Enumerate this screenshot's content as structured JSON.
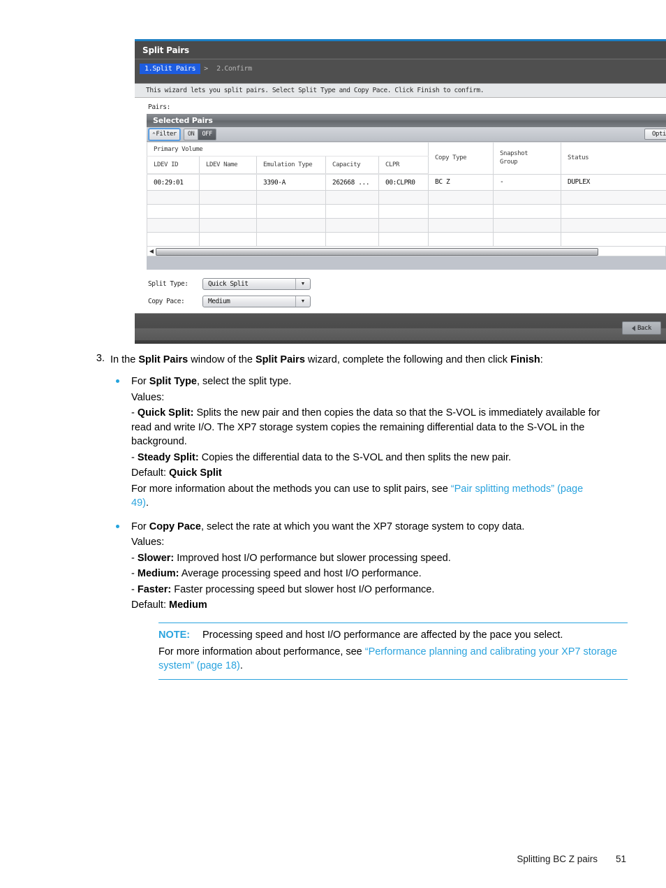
{
  "screenshot": {
    "window_title": "Split Pairs",
    "wizard_steps": [
      {
        "label": "1.Split Pairs",
        "active": true
      },
      {
        "label": "2.Confirm",
        "active": false
      }
    ],
    "step_separator": ">",
    "instruction": "This wizard lets you split pairs. Select Split Type and Copy Pace. Click Finish to confirm.",
    "pairs_label": "Pairs:",
    "panel": {
      "title": "Selected Pairs",
      "filter_button": "Filter",
      "filter_caret": "⌃",
      "toggle_on": "ON",
      "toggle_off": "OFF",
      "options_button": "Option"
    },
    "table": {
      "group_header": "Primary Volume",
      "columns": [
        "LDEV ID",
        "LDEV Name",
        "Emulation Type",
        "Capacity",
        "CLPR",
        "Copy Type",
        "Snapshot\nGroup",
        "Status"
      ],
      "column_snapshot_line1": "Snapshot",
      "column_snapshot_line2": "Group",
      "rows": [
        {
          "ldev_id": "00:29:01",
          "ldev_name": "",
          "emulation_type": "3390-A",
          "capacity": "262668 ...",
          "clpr": "00:CLPR0",
          "copy_type": "BC Z",
          "snapshot_group": "-",
          "status": "DUPLEX"
        }
      ],
      "empty_row_count": 4
    },
    "form": {
      "split_type_label": "Split Type:",
      "split_type_value": "Quick Split",
      "copy_pace_label": "Copy Pace:",
      "copy_pace_value": "Medium"
    },
    "footer": {
      "back_button": "Back"
    },
    "colors": {
      "accent": "#1b7fc4",
      "step_active_bg": "#1d5ce0",
      "titlebar": "#4a4a4a",
      "panel_footbar": "#c0c4cc"
    }
  },
  "document": {
    "step": {
      "number": "3.",
      "text_part1": "In the ",
      "bold1": "Split Pairs",
      "text_part2": " window of the ",
      "bold2": "Split Pairs",
      "text_part3": " wizard, complete the following and then click ",
      "bold3": "Finish",
      "text_part4": ":"
    },
    "bullets": [
      {
        "intro_pre": "For ",
        "intro_bold": "Split Type",
        "intro_post": ", select the split type.",
        "values_label": "Values:",
        "values": [
          {
            "prefix": "- ",
            "term": "Quick Split:",
            "desc": " Splits the new pair and then copies the data so that the S-VOL is immediately available for read and write I/O. The XP7 storage system copies the remaining differential data to the S-VOL in the background."
          },
          {
            "prefix": "- ",
            "term": "Steady Split:",
            "desc": " Copies the differential data to the S-VOL and then splits the new pair."
          }
        ],
        "default_label": "Default: ",
        "default_value": "Quick Split",
        "more_info_pre": "For more information about the methods you can use to split pairs, see ",
        "more_info_link": "“Pair splitting methods” (page 49)",
        "more_info_post": "."
      },
      {
        "intro_pre": "For ",
        "intro_bold": "Copy Pace",
        "intro_post": ", select the rate at which you want the XP7 storage system to copy data.",
        "values_label": "Values:",
        "values": [
          {
            "prefix": "- ",
            "term": "Slower:",
            "desc": " Improved host I/O performance but slower processing speed."
          },
          {
            "prefix": "- ",
            "term": "Medium:",
            "desc": " Average processing speed and host I/O performance."
          },
          {
            "prefix": "- ",
            "term": "Faster:",
            "desc": " Faster processing speed but slower host I/O performance."
          }
        ],
        "default_label": "Default: ",
        "default_value": "Medium"
      }
    ],
    "note": {
      "label": "NOTE:",
      "text": "Processing speed and host I/O performance are affected by the pace you select.",
      "para_pre": "For more information about performance, see ",
      "para_link": "“Performance planning and calibrating your XP7 storage system” (page 18)",
      "para_post": "."
    }
  },
  "page_footer": {
    "section": "Splitting BC Z pairs",
    "page_number": "51"
  }
}
